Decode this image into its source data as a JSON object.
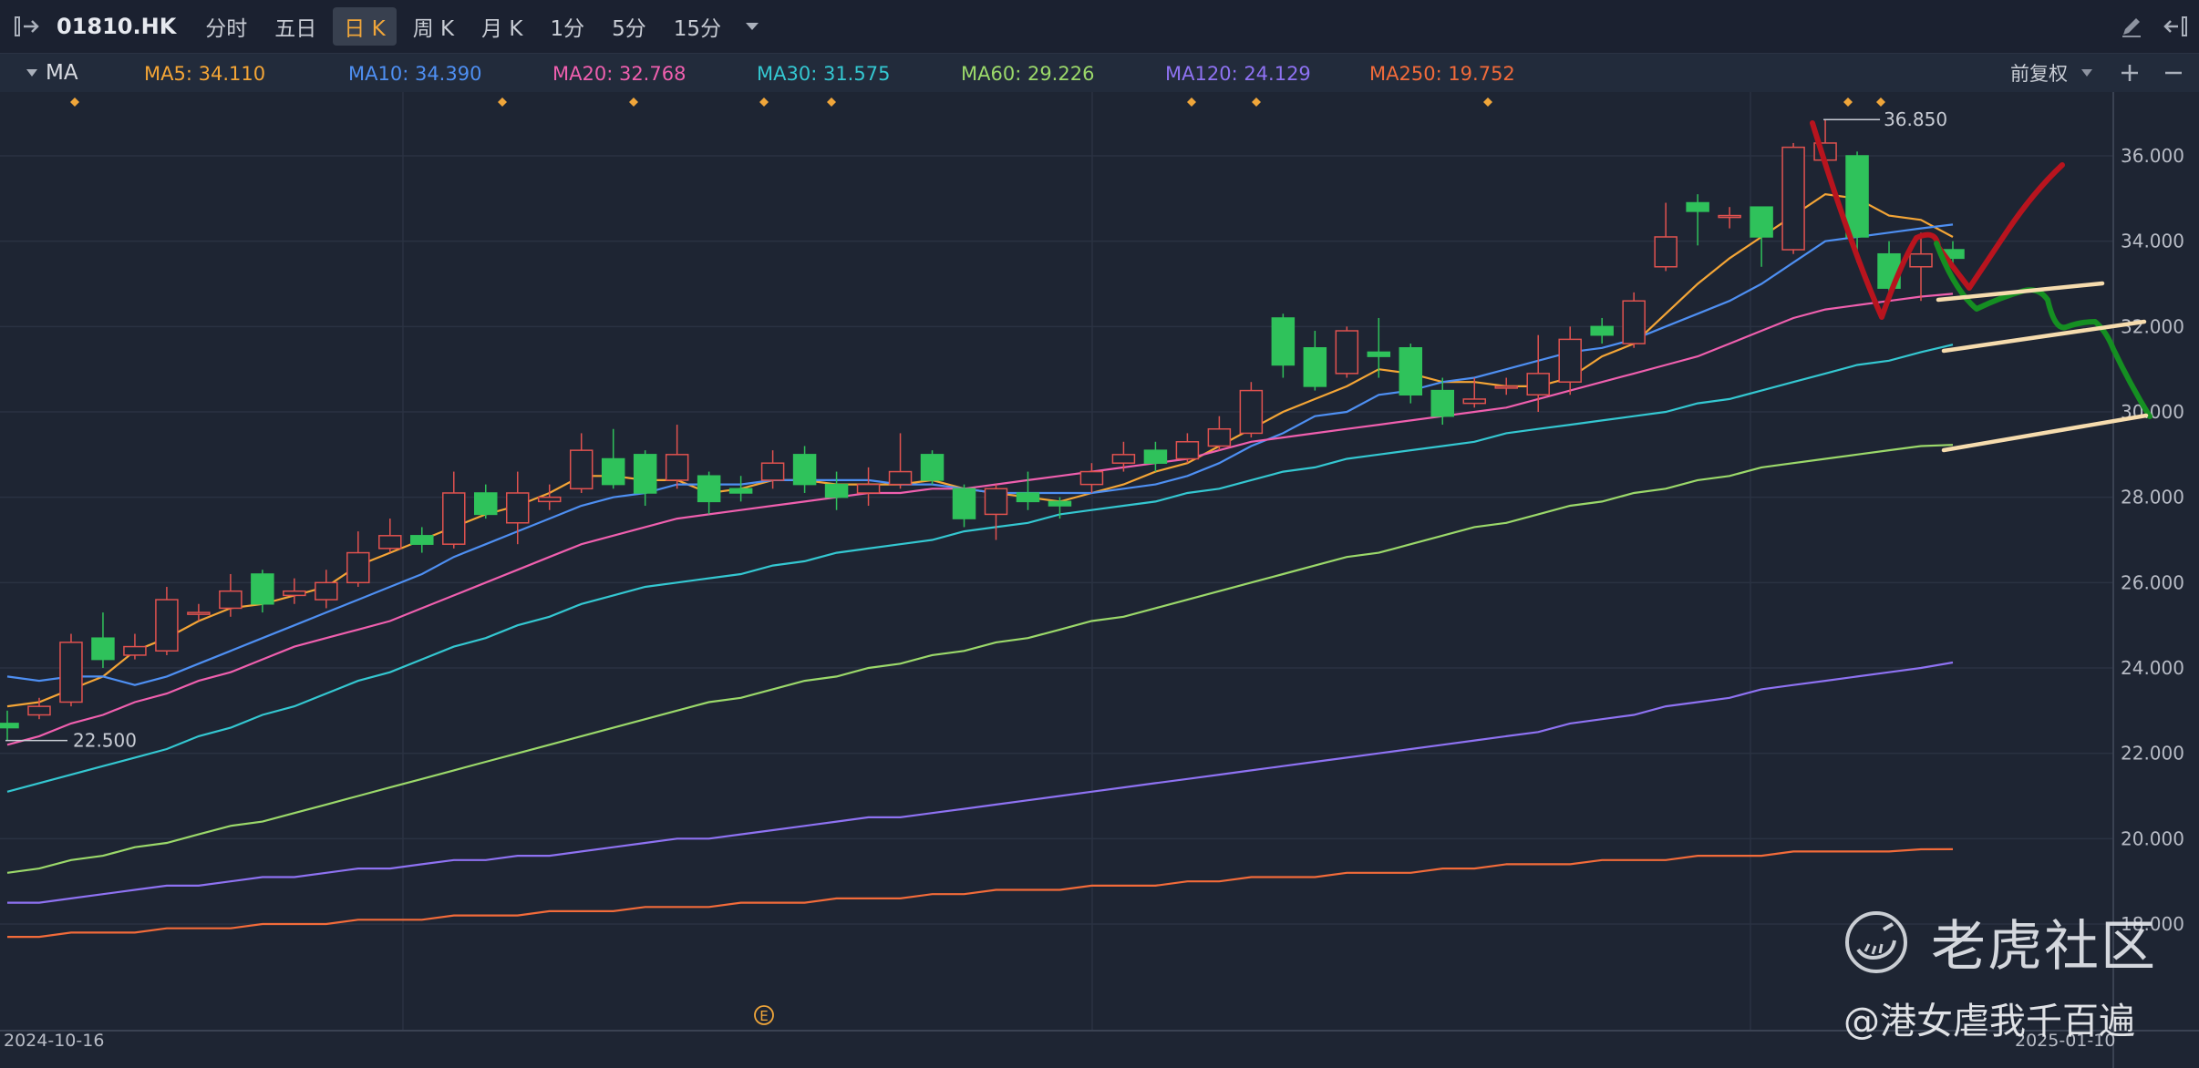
{
  "toolbar": {
    "symbol": "01810.HK",
    "timeframes": [
      {
        "label": "分时",
        "active": false
      },
      {
        "label": "五日",
        "active": false
      },
      {
        "label": "日 K",
        "active": true
      },
      {
        "label": "周 K",
        "active": false
      },
      {
        "label": "月 K",
        "active": false
      },
      {
        "label": "1分",
        "active": false
      },
      {
        "label": "5分",
        "active": false
      },
      {
        "label": "15分",
        "active": false
      }
    ],
    "icons": [
      "sidebar-toggle-icon",
      "dropdown-arrow-icon",
      "pencil-icon",
      "collapse-panel-icon"
    ]
  },
  "indicator": {
    "name": "MA",
    "items": [
      {
        "label": "MA5: 34.110",
        "color": "#f4a536"
      },
      {
        "label": "MA10: 34.390",
        "color": "#4e8ff2"
      },
      {
        "label": "MA20: 32.768",
        "color": "#ef5fae"
      },
      {
        "label": "MA30: 31.575",
        "color": "#34c7d1"
      },
      {
        "label": "MA60: 29.226",
        "color": "#9bd86a"
      },
      {
        "label": "MA120: 24.129",
        "color": "#8e72f2"
      },
      {
        "label": "MA250: 19.752",
        "color": "#f26b3a"
      }
    ],
    "adjust_label": "前复权"
  },
  "chart_data": {
    "type": "candlestick",
    "price_axis": [
      "36.000",
      "34.000",
      "32.000",
      "30.000",
      "28.000",
      "26.000",
      "24.000",
      "22.000",
      "20.000",
      "18.000"
    ],
    "ylim": [
      17.5,
      37.2
    ],
    "high_label": "36.850",
    "low_label": "22.500",
    "dates": [
      "2024-10-16",
      "2025-01-10"
    ],
    "event_marker": "E",
    "candles": [
      [
        22.7,
        22.6,
        23.0,
        22.3
      ],
      [
        22.9,
        23.1,
        23.3,
        22.8
      ],
      [
        23.2,
        24.6,
        24.8,
        23.1
      ],
      [
        24.7,
        24.2,
        25.3,
        24.0
      ],
      [
        24.3,
        24.5,
        24.8,
        24.2
      ],
      [
        24.4,
        25.6,
        25.9,
        24.3
      ],
      [
        25.3,
        25.3,
        25.5,
        25.1
      ],
      [
        25.4,
        25.8,
        26.2,
        25.2
      ],
      [
        26.2,
        25.5,
        26.3,
        25.3
      ],
      [
        25.7,
        25.8,
        26.1,
        25.5
      ],
      [
        25.6,
        26.0,
        26.3,
        25.4
      ],
      [
        26.0,
        26.7,
        27.2,
        25.9
      ],
      [
        26.8,
        27.1,
        27.5,
        26.7
      ],
      [
        27.1,
        26.9,
        27.3,
        26.7
      ],
      [
        26.9,
        28.1,
        28.6,
        26.8
      ],
      [
        28.1,
        27.6,
        28.3,
        27.5
      ],
      [
        27.4,
        28.1,
        28.6,
        26.9
      ],
      [
        27.9,
        28.0,
        28.3,
        27.7
      ],
      [
        28.2,
        29.1,
        29.5,
        28.1
      ],
      [
        28.9,
        28.3,
        29.6,
        28.2
      ],
      [
        29.0,
        28.1,
        29.1,
        27.8
      ],
      [
        28.4,
        29.0,
        29.7,
        28.2
      ],
      [
        28.5,
        27.9,
        28.6,
        27.6
      ],
      [
        28.2,
        28.1,
        28.5,
        27.9
      ],
      [
        28.4,
        28.8,
        29.1,
        28.2
      ],
      [
        29.0,
        28.3,
        29.2,
        28.1
      ],
      [
        28.3,
        28.0,
        28.6,
        27.7
      ],
      [
        28.1,
        28.3,
        28.7,
        27.8
      ],
      [
        28.3,
        28.6,
        29.5,
        28.2
      ],
      [
        29.0,
        28.4,
        29.1,
        28.3
      ],
      [
        28.2,
        27.5,
        28.3,
        27.3
      ],
      [
        27.6,
        28.2,
        28.3,
        27.0
      ],
      [
        28.1,
        27.9,
        28.6,
        27.7
      ],
      [
        27.9,
        27.8,
        28.0,
        27.5
      ],
      [
        28.3,
        28.6,
        28.8,
        28.1
      ],
      [
        28.8,
        29.0,
        29.3,
        28.6
      ],
      [
        29.1,
        28.8,
        29.3,
        28.6
      ],
      [
        28.9,
        29.3,
        29.5,
        28.8
      ],
      [
        29.2,
        29.6,
        29.9,
        29.1
      ],
      [
        29.5,
        30.5,
        30.7,
        29.4
      ],
      [
        32.2,
        31.1,
        32.3,
        30.8
      ],
      [
        31.5,
        30.6,
        31.9,
        30.5
      ],
      [
        30.9,
        31.9,
        32.0,
        30.8
      ],
      [
        31.4,
        31.3,
        32.2,
        30.8
      ],
      [
        31.5,
        30.4,
        31.6,
        30.2
      ],
      [
        30.5,
        29.9,
        30.8,
        29.7
      ],
      [
        30.2,
        30.3,
        30.8,
        30.1
      ],
      [
        30.6,
        30.6,
        30.8,
        30.4
      ],
      [
        30.4,
        30.9,
        31.8,
        30.0
      ],
      [
        30.7,
        31.7,
        32.0,
        30.4
      ],
      [
        32.0,
        31.8,
        32.2,
        31.6
      ],
      [
        31.6,
        32.6,
        32.8,
        31.5
      ],
      [
        33.4,
        34.1,
        34.9,
        33.3
      ],
      [
        34.9,
        34.7,
        35.1,
        33.9
      ],
      [
        34.6,
        34.6,
        34.8,
        34.3
      ],
      [
        34.8,
        34.1,
        34.8,
        33.4
      ],
      [
        33.8,
        36.2,
        36.3,
        33.7
      ],
      [
        35.9,
        36.3,
        36.85,
        35.7
      ],
      [
        36.0,
        34.1,
        36.1,
        33.5
      ],
      [
        33.7,
        32.9,
        34.0,
        32.6
      ],
      [
        33.4,
        33.7,
        34.2,
        32.6
      ],
      [
        33.8,
        33.6,
        34.0,
        33.4
      ]
    ],
    "series": [
      {
        "name": "MA5",
        "color": "#f4a536",
        "values": [
          23.1,
          23.2,
          23.5,
          23.8,
          24.4,
          24.7,
          25.1,
          25.4,
          25.5,
          25.7,
          25.9,
          26.4,
          26.7,
          27.0,
          27.3,
          27.6,
          27.8,
          28.1,
          28.5,
          28.5,
          28.4,
          28.4,
          28.1,
          28.2,
          28.4,
          28.4,
          28.3,
          28.3,
          28.3,
          28.4,
          28.2,
          28.1,
          28.0,
          27.9,
          28.1,
          28.3,
          28.6,
          28.8,
          29.2,
          29.6,
          30.0,
          30.3,
          30.6,
          31.0,
          30.9,
          30.7,
          30.7,
          30.6,
          30.6,
          30.8,
          31.3,
          31.6,
          32.3,
          33.0,
          33.6,
          34.1,
          34.6,
          35.1,
          35.0,
          34.6,
          34.5,
          34.1
        ]
      },
      {
        "name": "MA10",
        "color": "#4e8ff2",
        "values": [
          23.8,
          23.7,
          23.8,
          23.8,
          23.6,
          23.8,
          24.1,
          24.4,
          24.7,
          25.0,
          25.3,
          25.6,
          25.9,
          26.2,
          26.6,
          26.9,
          27.2,
          27.5,
          27.8,
          28.0,
          28.1,
          28.3,
          28.3,
          28.3,
          28.4,
          28.4,
          28.4,
          28.4,
          28.3,
          28.3,
          28.2,
          28.1,
          28.1,
          28.1,
          28.1,
          28.2,
          28.3,
          28.5,
          28.8,
          29.2,
          29.5,
          29.9,
          30.0,
          30.4,
          30.5,
          30.7,
          30.8,
          31.0,
          31.2,
          31.4,
          31.5,
          31.7,
          32.0,
          32.3,
          32.6,
          33.0,
          33.5,
          34.0,
          34.1,
          34.2,
          34.3,
          34.39
        ]
      },
      {
        "name": "MA20",
        "color": "#ef5fae",
        "values": [
          22.2,
          22.4,
          22.7,
          22.9,
          23.2,
          23.4,
          23.7,
          23.9,
          24.2,
          24.5,
          24.7,
          24.9,
          25.1,
          25.4,
          25.7,
          26.0,
          26.3,
          26.6,
          26.9,
          27.1,
          27.3,
          27.5,
          27.6,
          27.7,
          27.8,
          27.9,
          28.0,
          28.1,
          28.1,
          28.2,
          28.2,
          28.3,
          28.4,
          28.5,
          28.6,
          28.7,
          28.8,
          28.9,
          29.1,
          29.3,
          29.4,
          29.5,
          29.6,
          29.7,
          29.8,
          29.9,
          30.0,
          30.1,
          30.3,
          30.5,
          30.7,
          30.9,
          31.1,
          31.3,
          31.6,
          31.9,
          32.2,
          32.4,
          32.5,
          32.6,
          32.7,
          32.768
        ]
      },
      {
        "name": "MA30",
        "color": "#34c7d1",
        "values": [
          21.1,
          21.3,
          21.5,
          21.7,
          21.9,
          22.1,
          22.4,
          22.6,
          22.9,
          23.1,
          23.4,
          23.7,
          23.9,
          24.2,
          24.5,
          24.7,
          25.0,
          25.2,
          25.5,
          25.7,
          25.9,
          26.0,
          26.1,
          26.2,
          26.4,
          26.5,
          26.7,
          26.8,
          26.9,
          27.0,
          27.2,
          27.3,
          27.4,
          27.6,
          27.7,
          27.8,
          27.9,
          28.1,
          28.2,
          28.4,
          28.6,
          28.7,
          28.9,
          29.0,
          29.1,
          29.2,
          29.3,
          29.5,
          29.6,
          29.7,
          29.8,
          29.9,
          30.0,
          30.2,
          30.3,
          30.5,
          30.7,
          30.9,
          31.1,
          31.2,
          31.4,
          31.575
        ]
      },
      {
        "name": "MA60",
        "color": "#9bd86a",
        "values": [
          19.2,
          19.3,
          19.5,
          19.6,
          19.8,
          19.9,
          20.1,
          20.3,
          20.4,
          20.6,
          20.8,
          21.0,
          21.2,
          21.4,
          21.6,
          21.8,
          22.0,
          22.2,
          22.4,
          22.6,
          22.8,
          23.0,
          23.2,
          23.3,
          23.5,
          23.7,
          23.8,
          24.0,
          24.1,
          24.3,
          24.4,
          24.6,
          24.7,
          24.9,
          25.1,
          25.2,
          25.4,
          25.6,
          25.8,
          26.0,
          26.2,
          26.4,
          26.6,
          26.7,
          26.9,
          27.1,
          27.3,
          27.4,
          27.6,
          27.8,
          27.9,
          28.1,
          28.2,
          28.4,
          28.5,
          28.7,
          28.8,
          28.9,
          29.0,
          29.1,
          29.2,
          29.226
        ]
      },
      {
        "name": "MA120",
        "color": "#8e72f2",
        "values": [
          18.5,
          18.5,
          18.6,
          18.7,
          18.8,
          18.9,
          18.9,
          19.0,
          19.1,
          19.1,
          19.2,
          19.3,
          19.3,
          19.4,
          19.5,
          19.5,
          19.6,
          19.6,
          19.7,
          19.8,
          19.9,
          20.0,
          20.0,
          20.1,
          20.2,
          20.3,
          20.4,
          20.5,
          20.5,
          20.6,
          20.7,
          20.8,
          20.9,
          21.0,
          21.1,
          21.2,
          21.3,
          21.4,
          21.5,
          21.6,
          21.7,
          21.8,
          21.9,
          22.0,
          22.1,
          22.2,
          22.3,
          22.4,
          22.5,
          22.7,
          22.8,
          22.9,
          23.1,
          23.2,
          23.3,
          23.5,
          23.6,
          23.7,
          23.8,
          23.9,
          24.0,
          24.129
        ]
      },
      {
        "name": "MA250",
        "color": "#f26b3a",
        "values": [
          17.7,
          17.7,
          17.8,
          17.8,
          17.8,
          17.9,
          17.9,
          17.9,
          18.0,
          18.0,
          18.0,
          18.1,
          18.1,
          18.1,
          18.2,
          18.2,
          18.2,
          18.3,
          18.3,
          18.3,
          18.4,
          18.4,
          18.4,
          18.5,
          18.5,
          18.5,
          18.6,
          18.6,
          18.6,
          18.7,
          18.7,
          18.8,
          18.8,
          18.8,
          18.9,
          18.9,
          18.9,
          19.0,
          19.0,
          19.1,
          19.1,
          19.1,
          19.2,
          19.2,
          19.2,
          19.3,
          19.3,
          19.4,
          19.4,
          19.4,
          19.5,
          19.5,
          19.5,
          19.6,
          19.6,
          19.6,
          19.7,
          19.7,
          19.7,
          19.7,
          19.75,
          19.752
        ]
      }
    ]
  },
  "watermark": {
    "brand": "老虎社区",
    "user": "@港女虐我千百遍"
  }
}
